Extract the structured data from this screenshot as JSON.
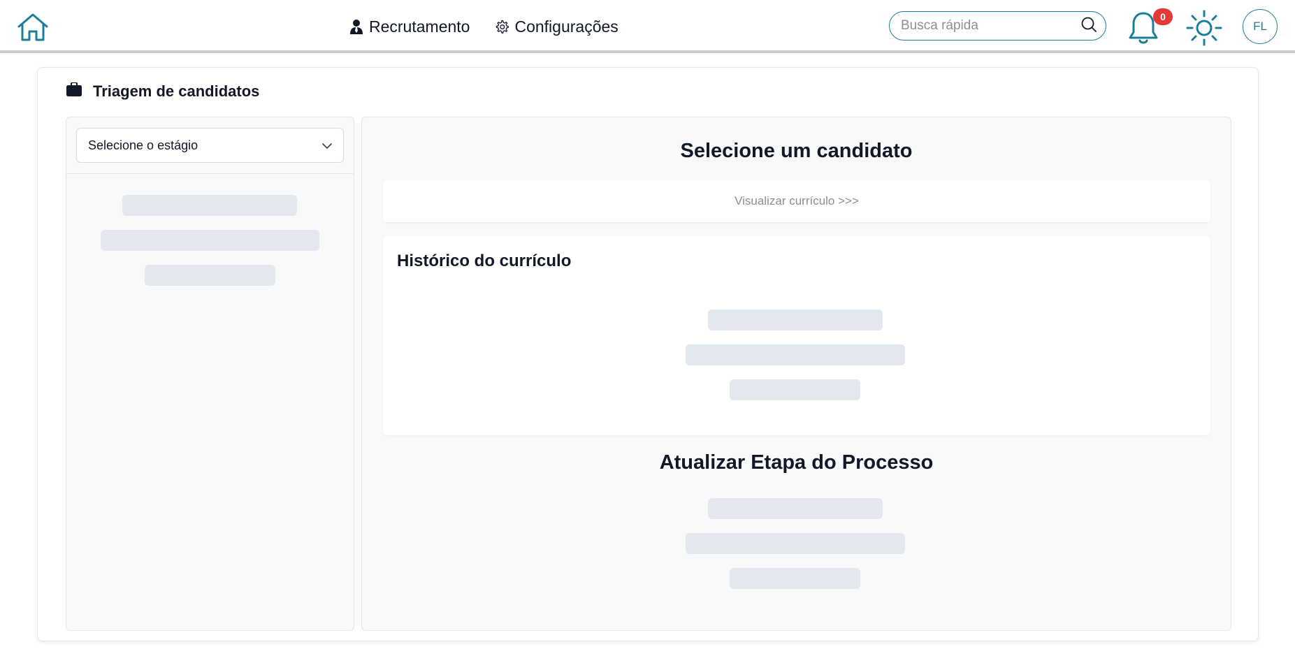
{
  "header": {
    "nav": [
      {
        "label": "Recrutamento",
        "icon": "user-tie-icon"
      },
      {
        "label": "Configurações",
        "icon": "gear-icon"
      }
    ],
    "search": {
      "placeholder": "Busca rápida",
      "value": ""
    },
    "notifications": {
      "count": "0"
    },
    "user": {
      "initials": "FL"
    },
    "accent_color": "#1b7e99",
    "badge_color": "#e53935"
  },
  "main": {
    "title": "Triagem de candidatos",
    "title_icon": "briefcase-icon",
    "stage_select": {
      "selected": "Selecione o estágio"
    },
    "candidate": {
      "title": "Selecione um candidato",
      "view_cv_label": "Visualizar currículo >>>"
    },
    "history": {
      "title": "Histórico do currículo"
    },
    "update": {
      "title": "Atualizar Etapa do Processo"
    }
  }
}
